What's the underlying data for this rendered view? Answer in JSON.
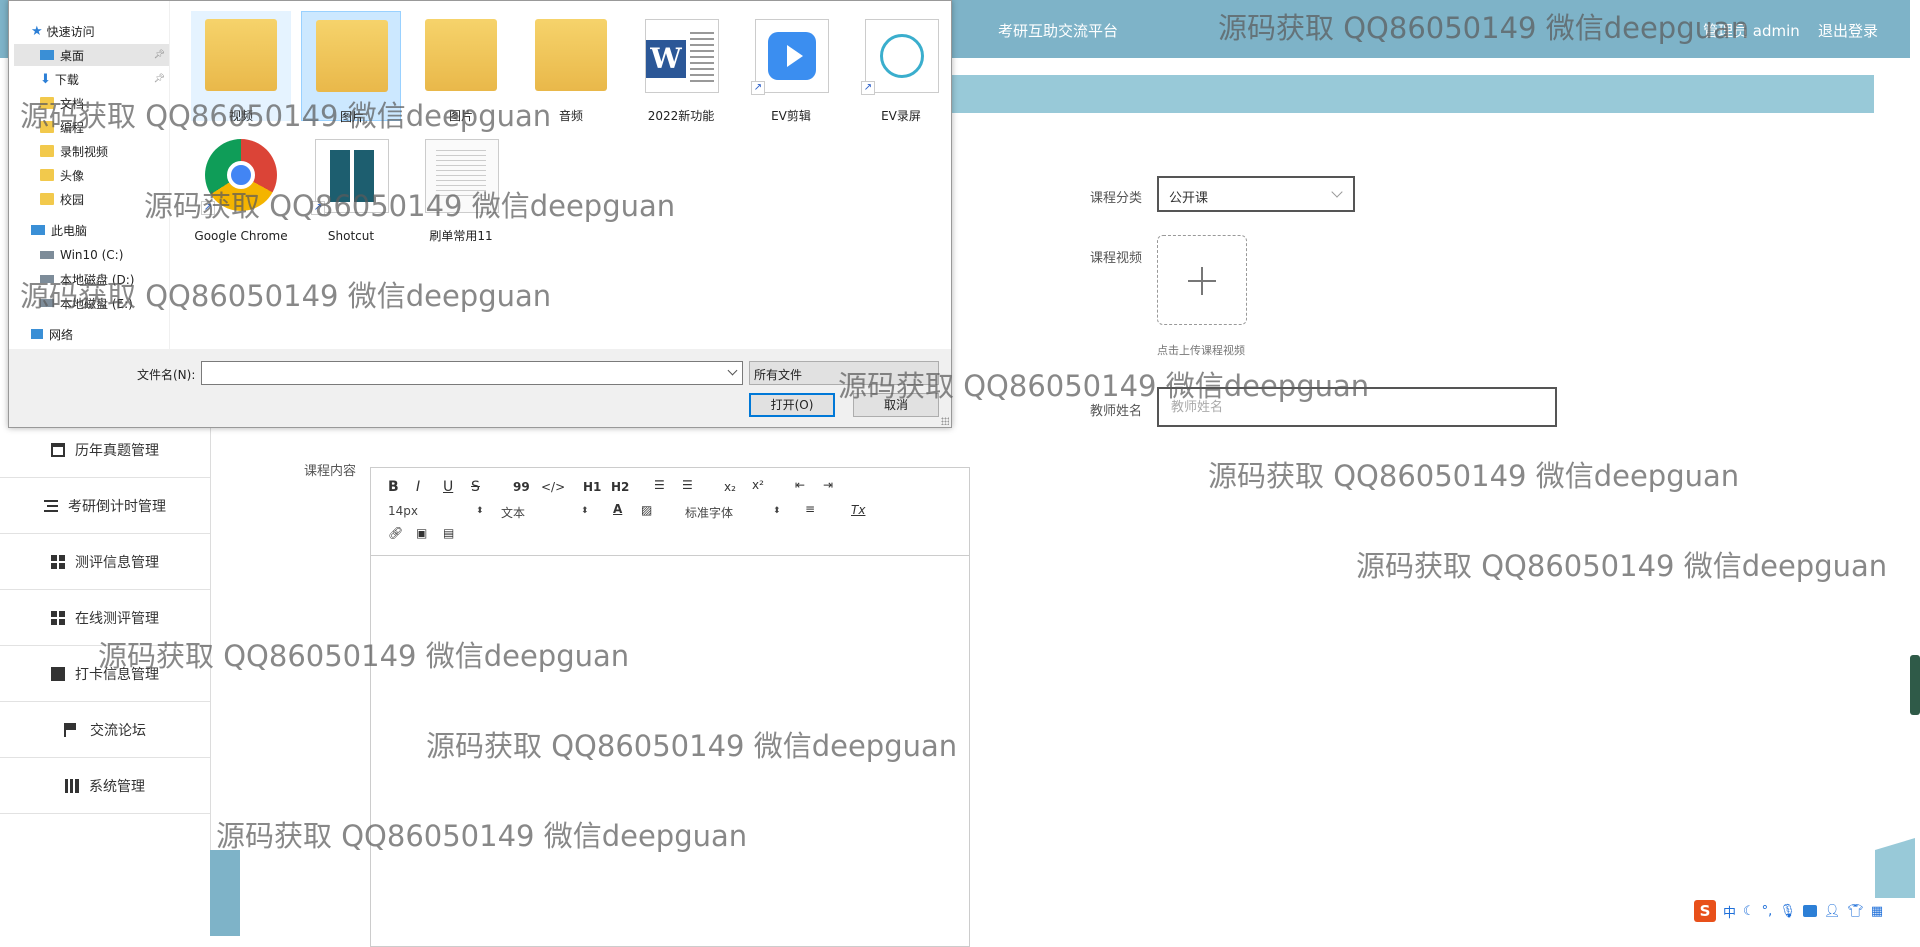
{
  "header": {
    "platform": "考研互助交流平台",
    "admin": "管理员 admin",
    "logout": "退出登录"
  },
  "sidebar": {
    "items": [
      {
        "label": "历年真题管理",
        "icon": "doc-icon"
      },
      {
        "label": "考研倒计时管理",
        "icon": "list-icon"
      },
      {
        "label": "测评信息管理",
        "icon": "grid-icon"
      },
      {
        "label": "在线测评管理",
        "icon": "grid-icon"
      },
      {
        "label": "打卡信息管理",
        "icon": "clipboard-icon"
      },
      {
        "label": "交流论坛",
        "icon": "flag-icon"
      },
      {
        "label": "系统管理",
        "icon": "book-icon"
      }
    ]
  },
  "form": {
    "category_label": "课程分类",
    "category_value": "公开课",
    "video_label": "课程视频",
    "upload_hint": "点击上传课程视频",
    "teacher_label": "教师姓名",
    "teacher_placeholder": "教师姓名",
    "content_label": "课程内容"
  },
  "editor": {
    "bold": "B",
    "italic": "I",
    "underline": "U",
    "strike": "S",
    "quote": "99",
    "code": "</>",
    "h1": "H1",
    "h2": "H2",
    "sub": "x₂",
    "sup": "x²",
    "font_size": "14px",
    "block_type": "文本",
    "font_family": "标准字体",
    "color_glyph": "A",
    "clean": "Tx"
  },
  "dialog": {
    "nav": [
      {
        "label": "快速访问",
        "icon": "star-icon"
      },
      {
        "label": "桌面",
        "icon": "desktop-icon",
        "selected": true
      },
      {
        "label": "下载",
        "icon": "download-icon"
      },
      {
        "label": "文档",
        "icon": "folder-icon"
      },
      {
        "label": "编程",
        "icon": "folder-icon"
      },
      {
        "label": "录制视频",
        "icon": "folder-icon"
      },
      {
        "label": "头像",
        "icon": "folder-icon"
      },
      {
        "label": "校园",
        "icon": "folder-icon"
      },
      {
        "label": "此电脑",
        "icon": "computer-icon"
      },
      {
        "label": "Win10 (C:)",
        "icon": "drive-icon"
      },
      {
        "label": "本地磁盘 (D:)",
        "icon": "drive-icon"
      },
      {
        "label": "本地磁盘 (E:)",
        "icon": "drive-icon"
      },
      {
        "label": "网络",
        "icon": "network-icon"
      }
    ],
    "files": [
      {
        "name": "视频",
        "icon": "video-folder-icon"
      },
      {
        "name": "图片",
        "icon": "picture-folder-icon"
      },
      {
        "name": "图片",
        "icon": "folder-icon"
      },
      {
        "name": "音频",
        "icon": "audio-folder-icon"
      },
      {
        "name": "2022新功能",
        "icon": "word-doc-icon"
      },
      {
        "name": "EV剪辑",
        "icon": "ev-editor-icon"
      },
      {
        "name": "EV录屏",
        "icon": "ev-recorder-icon"
      },
      {
        "name": "Google Chrome",
        "icon": "chrome-icon"
      },
      {
        "name": "Shotcut",
        "icon": "shotcut-icon"
      },
      {
        "name": "刷单常用11",
        "icon": "text-file-icon"
      }
    ],
    "filename_label": "文件名(N):",
    "filename_value": "",
    "filter_value": "所有文件",
    "open_button": "打开(O)",
    "cancel_button": "取消"
  },
  "watermark": "源码获取 QQ86050149 微信deepguan",
  "ime": {
    "logo": "S",
    "mode": "中"
  }
}
